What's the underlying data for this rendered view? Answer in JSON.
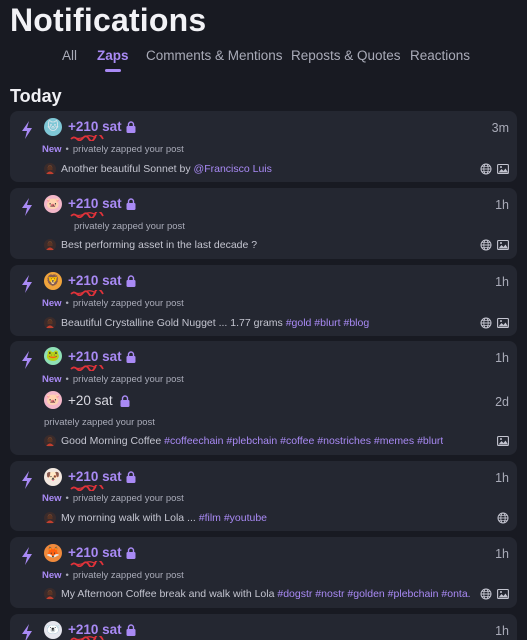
{
  "header": {
    "title": "Notifications"
  },
  "tabs": [
    {
      "label": "All"
    },
    {
      "label": "Zaps"
    },
    {
      "label": "Comments & Mentions"
    },
    {
      "label": "Reposts & Quotes"
    },
    {
      "label": "Reactions"
    }
  ],
  "section": {
    "title": "Today"
  },
  "colors": {
    "accent": "#a98af5",
    "background": "#181a22",
    "card": "#242731",
    "scribble": "#e0333a"
  },
  "notifications": [
    {
      "amount": "+210 sat",
      "time": "3m",
      "new_label": "New",
      "desc": "privately zapped your post",
      "avatar": "cat-face",
      "post_text": "Another beautiful Sonnet by",
      "post_mention": "@Francisco Luis",
      "post_tags": "",
      "icons": [
        "globe-icon",
        "image-icon"
      ]
    },
    {
      "amount": "+210 sat",
      "time": "1h",
      "new_label": "",
      "desc": "privately zapped your post",
      "avatar": "pig-face",
      "post_text": "Best performing asset in the last decade ?",
      "post_mention": "",
      "post_tags": "",
      "icons": [
        "globe-icon",
        "image-icon"
      ]
    },
    {
      "amount": "+210 sat",
      "time": "1h",
      "new_label": "New",
      "desc": "privately zapped your post",
      "avatar": "lion-face",
      "post_text": "Beautiful Crystalline Gold Nugget ... 1.77 grams",
      "post_mention": "",
      "post_tags": "#gold #blurt #blog",
      "icons": [
        "globe-icon",
        "image-icon"
      ]
    },
    {
      "amount": "+210 sat",
      "time": "1h",
      "new_label": "New",
      "desc": "privately zapped your post",
      "avatar": "frog-face",
      "second": {
        "amount": "+20 sat",
        "time": "2d",
        "desc": "privately zapped your post",
        "avatar": "pig-face"
      },
      "post_text": "Good Morning Coffee",
      "post_mention": "",
      "post_tags": "#coffeechain #plebchain #coffee #nostriches #memes #blurt",
      "icons": [
        "image-icon"
      ]
    },
    {
      "amount": "+210 sat",
      "time": "1h",
      "new_label": "New",
      "desc": "privately zapped your post",
      "avatar": "dog-face",
      "post_text": "My morning walk with Lola ...",
      "post_mention": "",
      "post_tags": "#film #youtube",
      "icons": [
        "globe-icon"
      ]
    },
    {
      "amount": "+210 sat",
      "time": "1h",
      "new_label": "New",
      "desc": "privately zapped your post",
      "avatar": "fox-face",
      "post_text": "My Afternoon Coffee break and walk with Lola",
      "post_mention": "",
      "post_tags": "#dogstr #nostr #golden #plebchain #onta...",
      "icons": [
        "globe-icon",
        "image-icon"
      ]
    },
    {
      "amount": "+210 sat",
      "time": "1h",
      "avatar": "bear-face"
    }
  ]
}
